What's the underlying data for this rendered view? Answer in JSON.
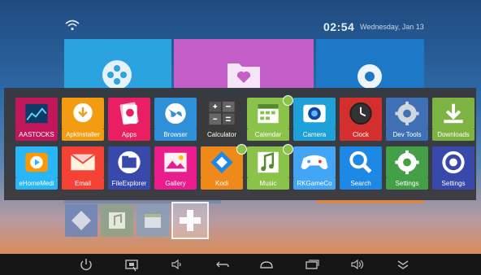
{
  "status": {
    "time": "02:54",
    "date": "Wednesday, Jan 13"
  },
  "drawer": {
    "row1": [
      {
        "label": "AASTOCKS",
        "icon": "aastocks-icon",
        "color": "#c2185b"
      },
      {
        "label": "ApkInstaller",
        "icon": "apk-installer-icon",
        "color": "#f39c12"
      },
      {
        "label": "Apps",
        "icon": "apps-icon",
        "color": "#e91e63"
      },
      {
        "label": "Browser",
        "icon": "globe-icon",
        "color": "#2f8fd8"
      },
      {
        "label": "Calculator",
        "icon": "calculator-icon",
        "color": "#3a3a3a"
      },
      {
        "label": "Calendar",
        "icon": "calendar-icon",
        "color": "#8bc34a",
        "installed": true
      },
      {
        "label": "Camera",
        "icon": "camera-icon",
        "color": "#1ea0d8"
      },
      {
        "label": "Clock",
        "icon": "clock-icon",
        "color": "#d32f2f"
      },
      {
        "label": "Dev Tools",
        "icon": "gear-icon",
        "color": "#3f6fb5"
      },
      {
        "label": "Downloads",
        "icon": "download-icon",
        "color": "#7cb342"
      }
    ],
    "row2": [
      {
        "label": "eHomeMedi",
        "icon": "media-icon",
        "color": "#29b6f6"
      },
      {
        "label": "Email",
        "icon": "envelope-icon",
        "color": "#f44336"
      },
      {
        "label": "FileExplorer",
        "icon": "folder-icon",
        "color": "#3949ab"
      },
      {
        "label": "Gallery",
        "icon": "picture-icon",
        "color": "#e91e8c"
      },
      {
        "label": "Kodi",
        "icon": "kodi-icon",
        "color": "#ef8a1a",
        "installed": true
      },
      {
        "label": "Music",
        "icon": "music-icon",
        "color": "#8bc34a",
        "installed": true
      },
      {
        "label": "RKGameCo",
        "icon": "gamepad-icon",
        "color": "#42a5f5"
      },
      {
        "label": "Search",
        "icon": "search-icon",
        "color": "#1e88e5"
      },
      {
        "label": "Settings",
        "icon": "settings-icon",
        "color": "#43a047"
      },
      {
        "label": "Settings",
        "icon": "settings-alt-icon",
        "color": "#3949ab"
      }
    ]
  },
  "navbar": [
    "power-icon",
    "screenshot-icon",
    "volume-down-icon",
    "back-icon",
    "home-icon",
    "recent-apps-icon",
    "volume-up-icon",
    "collapse-icon"
  ]
}
